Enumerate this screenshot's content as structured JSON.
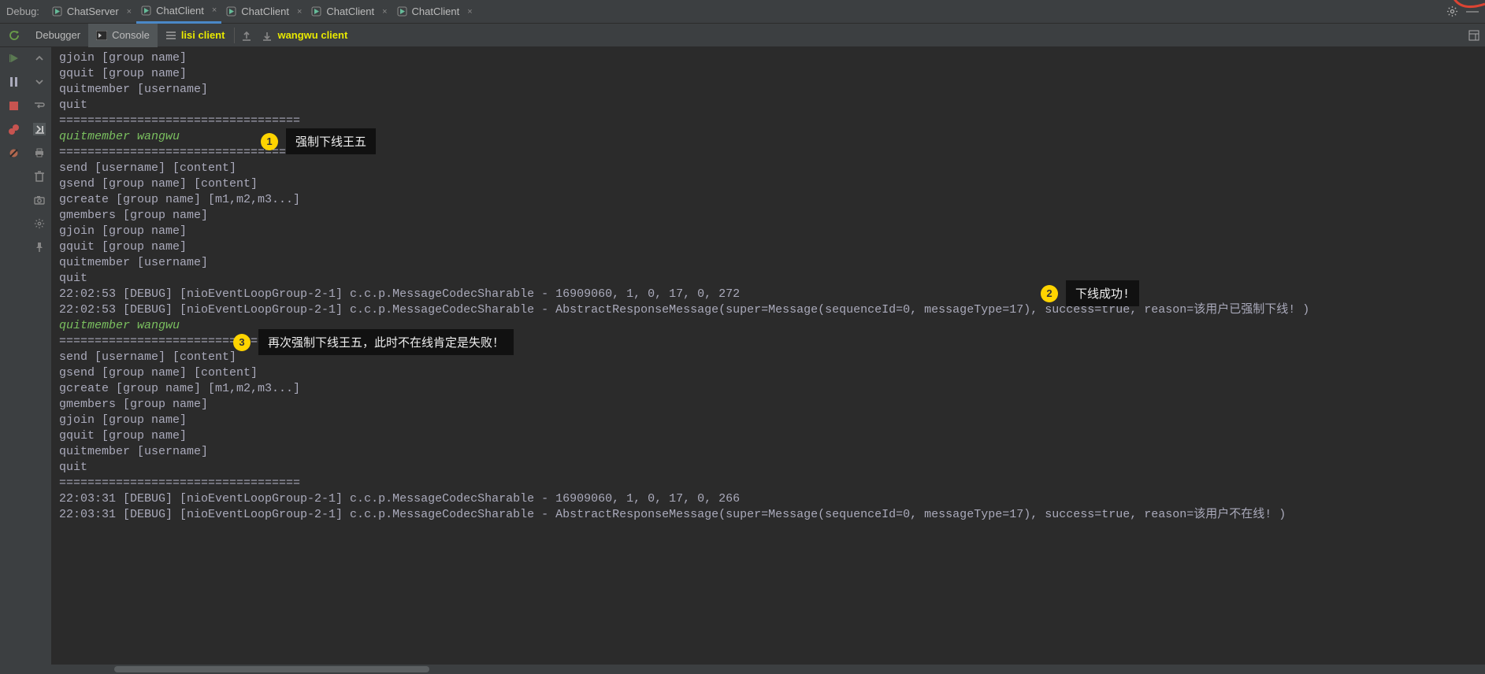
{
  "topbar": {
    "debug_label": "Debug:",
    "tabs": [
      {
        "label": "ChatServer"
      },
      {
        "label": "ChatClient"
      },
      {
        "label": "ChatClient"
      },
      {
        "label": "ChatClient"
      },
      {
        "label": "ChatClient"
      }
    ]
  },
  "toolbar": {
    "debugger_label": "Debugger",
    "console_label": "Console",
    "lisi_client": "lisi client",
    "wangwu_client": "wangwu client"
  },
  "console": {
    "lines": [
      "gjoin [group name]",
      "gquit [group name]",
      "quitmember [username]",
      "quit",
      "==================================",
      "quitmember wangwu",
      "==================================",
      "send [username] [content]",
      "gsend [group name] [content]",
      "gcreate [group name] [m1,m2,m3...]",
      "gmembers [group name]",
      "gjoin [group name]",
      "gquit [group name]",
      "quitmember [username]",
      "quit",
      "",
      "22:02:53 [DEBUG] [nioEventLoopGroup-2-1] c.c.p.MessageCodecSharable - 16909060, 1, 0, 17, 0, 272",
      "22:02:53 [DEBUG] [nioEventLoopGroup-2-1] c.c.p.MessageCodecSharable - AbstractResponseMessage(super=Message(sequenceId=0, messageType=17), success=true, reason=该用户已强制下线! )",
      "quitmember wangwu",
      "==================================",
      "send [username] [content]",
      "gsend [group name] [content]",
      "gcreate [group name] [m1,m2,m3...]",
      "gmembers [group name]",
      "gjoin [group name]",
      "gquit [group name]",
      "quitmember [username]",
      "quit",
      "==================================",
      "22:03:31 [DEBUG] [nioEventLoopGroup-2-1] c.c.p.MessageCodecSharable - 16909060, 1, 0, 17, 0, 266",
      "22:03:31 [DEBUG] [nioEventLoopGroup-2-1] c.c.p.MessageCodecSharable - AbstractResponseMessage(super=Message(sequenceId=0, messageType=17), success=true, reason=该用户不在线! )"
    ],
    "input_line_indices": [
      5,
      18
    ]
  },
  "annotations": [
    {
      "n": "1",
      "text": "强制下线王五"
    },
    {
      "n": "2",
      "text": "下线成功!"
    },
    {
      "n": "3",
      "text": "再次强制下线王五，此时不在线肯定是失败！"
    }
  ]
}
